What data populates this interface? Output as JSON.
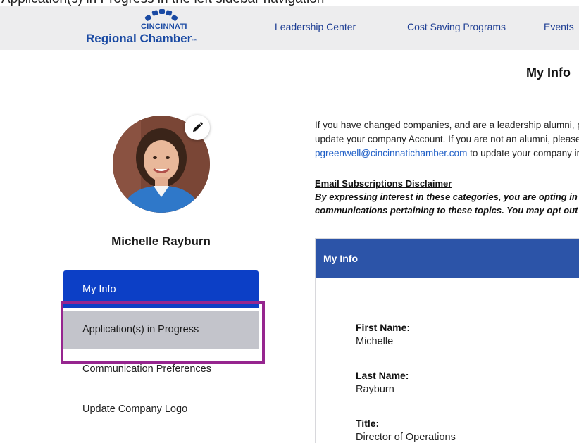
{
  "top_cut_text": "Application(s) in Progress  in the left sidebar navigation",
  "header": {
    "logo": {
      "line1": "CINCINNATI",
      "line2": "Regional Chamber",
      "tm": "™"
    },
    "nav": [
      {
        "label": "Leadership Center"
      },
      {
        "label": "Cost Saving Programs"
      },
      {
        "label": "Events"
      }
    ]
  },
  "page_title": "My Info",
  "profile": {
    "name": "Michelle Rayburn",
    "edit_icon": "pencil-icon"
  },
  "sidebar": {
    "items": [
      {
        "label": "My Info",
        "active": true
      },
      {
        "label": "Application(s) in Progress",
        "highlighted": true
      },
      {
        "label": "Communication Preferences"
      },
      {
        "label": "Update Company Logo"
      }
    ]
  },
  "intro": {
    "line1": "If you have changed companies, and are a leadership alumni, please contact us to",
    "line2": "update your company Account. If you are not an alumni, please contact",
    "email": "pgreenwell@cincinnatichamber.com",
    "line3_rest": " to update your company information."
  },
  "disclaimer": {
    "title": "Email Subscriptions Disclaimer",
    "line1": "By expressing interest in these categories, you are opting in to receive",
    "line2": "communications pertaining to these topics. You may opt out at any time."
  },
  "panel": {
    "title": "My Info",
    "fields": [
      {
        "label": "First Name:",
        "value": "Michelle"
      },
      {
        "label": "Last Name:",
        "value": "Rayburn"
      },
      {
        "label": "Title:",
        "value": "Director of Operations"
      }
    ]
  },
  "colors": {
    "brand_blue": "#1a4aa3",
    "active_item": "#0c3fc6",
    "hover_item": "#c3c4cb",
    "panel_header": "#2c54a8",
    "highlight_border": "#96258f",
    "link": "#1f5fc7"
  }
}
